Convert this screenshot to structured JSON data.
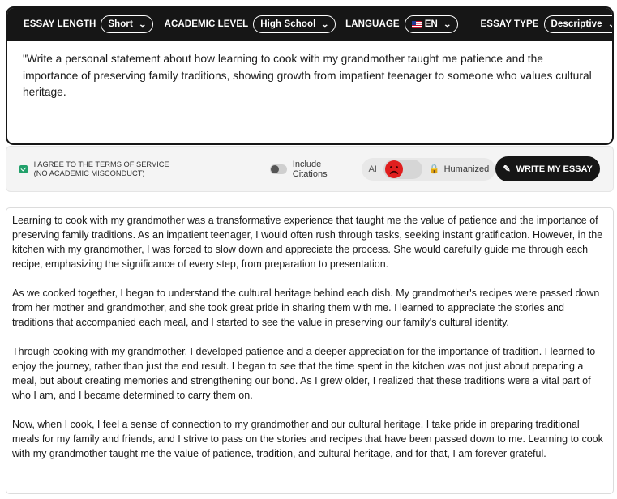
{
  "toolbar": {
    "essay_length_label": "ESSAY LENGTH",
    "essay_length_value": "Short",
    "academic_level_label": "ACADEMIC LEVEL",
    "academic_level_value": "High School",
    "language_label": "LANGUAGE",
    "language_value": "EN",
    "essay_type_label": "ESSAY TYPE",
    "essay_type_value": "Descriptive"
  },
  "prompt": {
    "text": "\"Write a personal statement about how learning to cook with my grandmother taught me patience and the importance of preserving family traditions, showing growth from impatient teenager to someone who values cultural heritage."
  },
  "controls": {
    "terms_line1": "I AGREE TO THE TERMS OF SERVICE",
    "terms_line2": "(NO ACADEMIC MISCONDUCT)",
    "terms_checked": true,
    "citations_label": "Include Citations",
    "citations_enabled": false,
    "ai_label": "AI",
    "humanized_label": "Humanized",
    "write_button_label": "WRITE MY ESSAY"
  },
  "output": {
    "paragraphs": [
      "Learning to cook with my grandmother was a transformative experience that taught me the value of patience and the importance of preserving family traditions. As an impatient teenager, I would often rush through tasks, seeking instant gratification. However, in the kitchen with my grandmother, I was forced to slow down and appreciate the process. She would carefully guide me through each recipe, emphasizing the significance of every step, from preparation to presentation.",
      "As we cooked together, I began to understand the cultural heritage behind each dish. My grandmother's recipes were passed down from her mother and grandmother, and she took great pride in sharing them with me. I learned to appreciate the stories and traditions that accompanied each meal, and I started to see the value in preserving our family's cultural identity.",
      "Through cooking with my grandmother, I developed patience and a deeper appreciation for the importance of tradition. I learned to enjoy the journey, rather than just the end result. I began to see that the time spent in the kitchen was not just about preparing a meal, but about creating memories and strengthening our bond. As I grew older, I realized that these traditions were a vital part of who I am, and I became determined to carry them on.",
      "Now, when I cook, I feel a sense of connection to my grandmother and our cultural heritage. I take pride in preparing traditional meals for my family and friends, and I strive to pass on the stories and recipes that have been passed down to me. Learning to cook with my grandmother taught me the value of patience, tradition, and cultural heritage, and for that, I am forever grateful."
    ]
  },
  "colors": {
    "dark": "#161616",
    "check_green": "#21a06a",
    "face_red": "#e01e1e",
    "lock_gold": "#e0a200"
  },
  "icons": [
    "chevron-down-icon",
    "us-flag-icon",
    "check-icon",
    "sad-face-icon",
    "lock-icon",
    "pencil-icon"
  ]
}
